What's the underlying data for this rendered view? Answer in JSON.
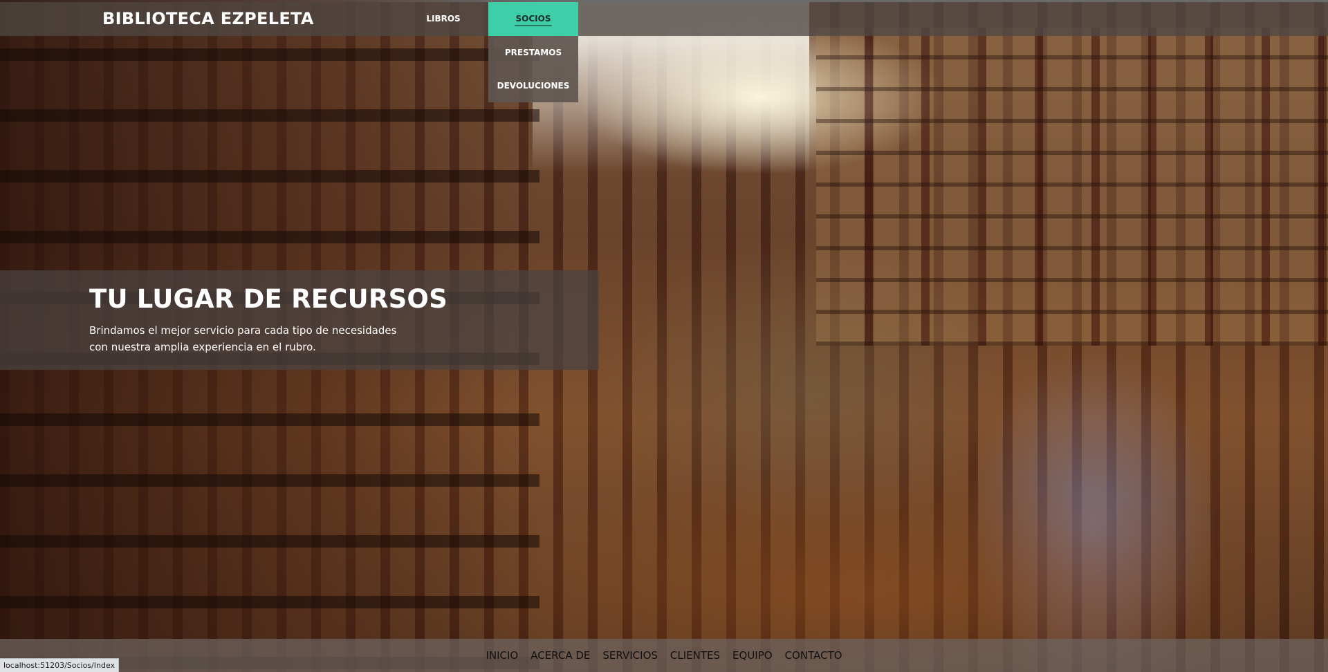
{
  "brand": {
    "name": "BIBLIOTECA EZPELETA"
  },
  "nav": {
    "items": [
      {
        "label": "LIBROS"
      },
      {
        "label": "SOCIOS",
        "active": true
      },
      {
        "label": "PRESTAMOS"
      },
      {
        "label": "DEVOLUCIONES"
      }
    ]
  },
  "hero": {
    "title": "TU LUGAR DE RECURSOS",
    "line1": "Brindamos el mejor servicio para cada tipo de necesidades",
    "line2": "con nuestra amplia experiencia en el rubro."
  },
  "footer": {
    "links": [
      {
        "label": "INICIO"
      },
      {
        "label": "ACERCA DE"
      },
      {
        "label": "SERVICIOS"
      },
      {
        "label": "CLIENTES"
      },
      {
        "label": "EQUIPO"
      },
      {
        "label": "CONTACTO"
      }
    ]
  },
  "status": {
    "url": "localhost:51203/Socios/Index"
  },
  "colors": {
    "active_tab": "#3ecfa9",
    "bar_bg": "#504844",
    "dropdown_bg": "#5f5650"
  }
}
